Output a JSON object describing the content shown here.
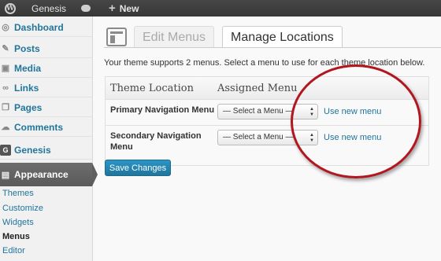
{
  "adminbar": {
    "site_name": "Genesis",
    "new_label": "New",
    "new_symbol": "+"
  },
  "sidebar": {
    "items": [
      {
        "label": "Dashboard",
        "icon": "dashboard-icon"
      },
      {
        "label": "Posts",
        "icon": "posts-icon"
      },
      {
        "label": "Media",
        "icon": "media-icon"
      },
      {
        "label": "Links",
        "icon": "links-icon"
      },
      {
        "label": "Pages",
        "icon": "pages-icon"
      },
      {
        "label": "Comments",
        "icon": "comments-icon"
      },
      {
        "label": "Genesis",
        "icon": "genesis-icon"
      },
      {
        "label": "Appearance",
        "icon": "appearance-icon"
      }
    ],
    "submenu": [
      "Themes",
      "Customize",
      "Widgets",
      "Menus",
      "Editor"
    ],
    "active_submenu": "Menus"
  },
  "main": {
    "tabs": [
      {
        "label": "Edit Menus",
        "active": false
      },
      {
        "label": "Manage Locations",
        "active": true
      }
    ],
    "intro": "Your theme supports 2 menus. Select a menu to use for each theme location below.",
    "table": {
      "headers": [
        "Theme Location",
        "Assigned Menu"
      ],
      "rows": [
        {
          "location": "Primary Navigation Menu",
          "select_value": "— Select a Menu —",
          "link": "Use new menu"
        },
        {
          "location": "Secondary Navigation Menu",
          "select_value": "— Select a Menu —",
          "link": "Use new menu"
        }
      ]
    },
    "save_button": "Save Changes"
  },
  "colors": {
    "link": "#21759b",
    "highlight_circle": "#b0171e",
    "button": "#21759b"
  }
}
